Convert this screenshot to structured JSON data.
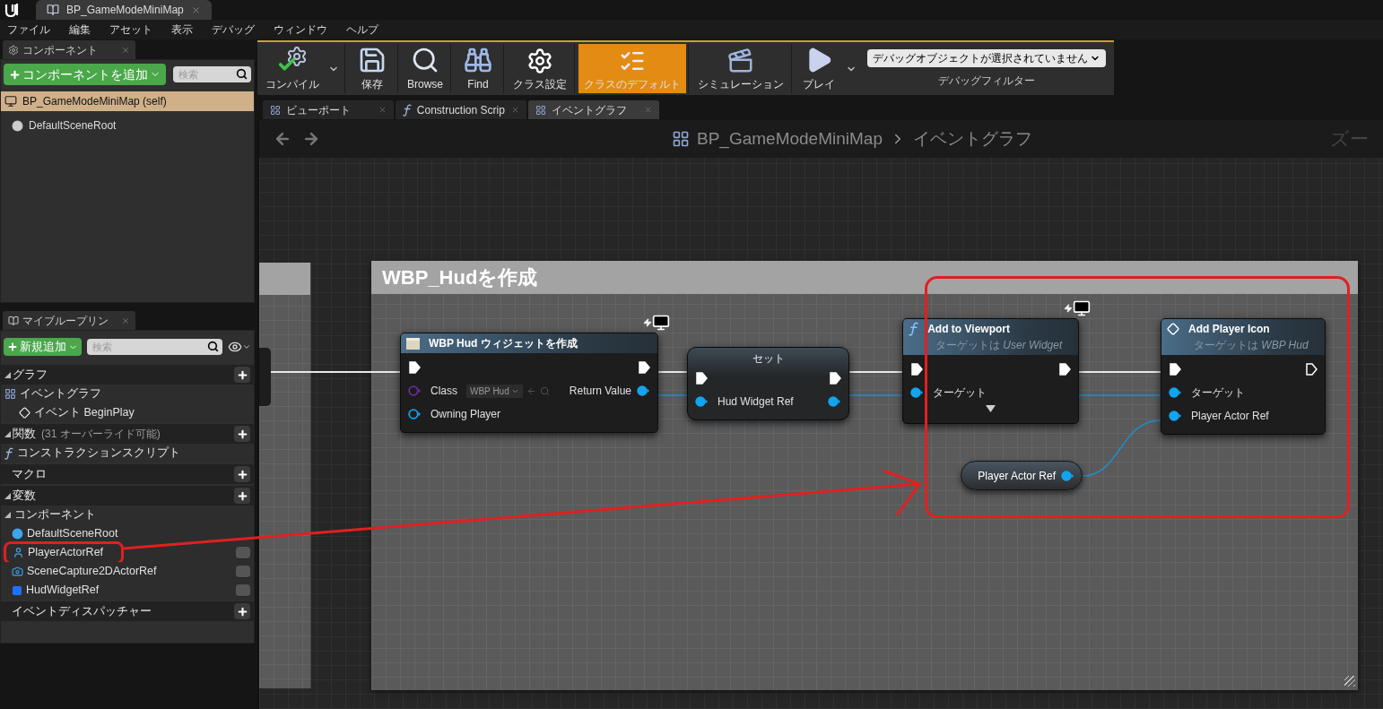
{
  "title_bar": {
    "tab": "BP_GameModeMiniMap"
  },
  "menu": [
    "ファイル",
    "編集",
    "アセット",
    "表示",
    "デバッグ",
    "ウィンドウ",
    "ヘルプ"
  ],
  "components_panel": {
    "tab": "コンポーネント",
    "add_button": "コンポーネントを追加",
    "search": {
      "placeholder": "検索"
    },
    "items": [
      {
        "label": "BP_GameModeMiniMap (self)",
        "kind": "blueprint",
        "selected": true
      },
      {
        "label": "DefaultSceneRoot",
        "kind": "scene",
        "selected": false
      }
    ]
  },
  "my_blueprint": {
    "tab": "マイブループリン",
    "add_button": "新規追加",
    "search": {
      "placeholder": "検索"
    },
    "sections": [
      {
        "title": "グラフ",
        "expanded": true,
        "items": [
          {
            "label": "イベントグラフ",
            "kind": "graph",
            "children": [
              {
                "label": "イベント BeginPlay",
                "kind": "event"
              }
            ]
          }
        ]
      },
      {
        "title": "関数",
        "note": "(31 オーバーライド可能)",
        "expanded": true,
        "items": [
          {
            "label": "コンストラクションスクリプト",
            "kind": "construction"
          }
        ]
      },
      {
        "title": "マクロ",
        "expanded": false
      },
      {
        "title": "変数",
        "expanded": true,
        "items": [
          {
            "label": "コンポーネント",
            "kind": "category",
            "children": [
              {
                "label": "DefaultSceneRoot",
                "kind": "scene",
                "visibility_toggle": false,
                "annotated": false
              },
              {
                "label": "PlayerActorRef",
                "kind": "actor",
                "visibility_toggle": true,
                "annotated": true
              },
              {
                "label": "SceneCapture2DActorRef",
                "kind": "capture",
                "visibility_toggle": true,
                "annotated": false
              },
              {
                "label": "HudWidgetRef",
                "kind": "widget",
                "visibility_toggle": true,
                "annotated": false
              }
            ]
          }
        ]
      },
      {
        "title": "イベントディスパッチャー",
        "expanded": false
      }
    ]
  },
  "toolbar": {
    "buttons": [
      {
        "label": "コンパイル",
        "kind": "compile",
        "dropdown": true,
        "selected": false
      },
      {
        "label": "保存",
        "kind": "save",
        "dropdown": false,
        "selected": false
      },
      {
        "label": "Browse",
        "kind": "browse",
        "dropdown": false,
        "selected": false
      },
      {
        "label": "Find",
        "kind": "find",
        "dropdown": false,
        "selected": false
      },
      {
        "label": "クラス設定",
        "kind": "class_settings",
        "dropdown": false,
        "selected": false
      },
      {
        "label": "クラスのデフォルト",
        "kind": "class_defaults",
        "dropdown": false,
        "selected": true
      },
      {
        "label": "シミュレーション",
        "kind": "simulation",
        "dropdown": false,
        "selected": false
      },
      {
        "label": "プレイ",
        "kind": "play",
        "dropdown": true,
        "selected": false
      }
    ],
    "debug_filter": {
      "value": "デバッグオブジェクトが選択されていません",
      "label": "デバッグフィルター"
    }
  },
  "editor_tabs": [
    {
      "label": "ビューポート",
      "kind": "viewport",
      "selected": false
    },
    {
      "label": "Construction Scrip",
      "kind": "function",
      "selected": false
    },
    {
      "label": "イベントグラフ",
      "kind": "graph",
      "selected": true
    }
  ],
  "graph": {
    "breadcrumb": [
      "BP_GameModeMiniMap",
      "イベントグラフ"
    ],
    "zoom_label": "ズー",
    "comment": {
      "title": "WBP_Hudを作成"
    },
    "nodes": [
      {
        "kind": "create_widget",
        "title": "WBP Hud ウィジェットを作成",
        "network_badge": true,
        "inputs": [
          {
            "kind": "exec",
            "connected": true
          },
          {
            "kind": "class",
            "label": "Class",
            "default": "WBP Hud",
            "connected": false
          },
          {
            "kind": "object",
            "label": "Owning Player",
            "connected": false
          }
        ],
        "outputs": [
          {
            "kind": "exec",
            "connected": true
          },
          {
            "kind": "object",
            "label": "Return Value",
            "connected": true
          }
        ]
      },
      {
        "kind": "set",
        "title": "セット",
        "inputs": [
          {
            "kind": "exec",
            "connected": true
          },
          {
            "kind": "object",
            "label": "Hud Widget Ref",
            "connected": true
          }
        ],
        "outputs": [
          {
            "kind": "exec",
            "connected": true
          },
          {
            "kind": "object",
            "connected": true
          }
        ]
      },
      {
        "kind": "function",
        "title": "Add to Viewport",
        "subtitle": "ターゲットは *User Widget*",
        "network_badge": true,
        "advanced_toggle": true,
        "inputs": [
          {
            "kind": "exec",
            "connected": true
          },
          {
            "kind": "object",
            "label": "ターゲット",
            "connected": true
          }
        ],
        "outputs": [
          {
            "kind": "exec",
            "connected": true
          }
        ]
      },
      {
        "kind": "event_call",
        "title": "Add Player Icon",
        "subtitle": "ターゲットは *WBP Hud*",
        "inputs": [
          {
            "kind": "exec",
            "connected": true
          },
          {
            "kind": "object",
            "label": "ターゲット",
            "connected": true
          },
          {
            "kind": "object",
            "label": "Player Actor Ref",
            "connected": true
          }
        ],
        "outputs": [
          {
            "kind": "exec",
            "connected": false
          }
        ]
      },
      {
        "kind": "getter",
        "title": "Player Actor Ref",
        "outputs": [
          {
            "kind": "object",
            "connected": true
          }
        ]
      }
    ]
  }
}
